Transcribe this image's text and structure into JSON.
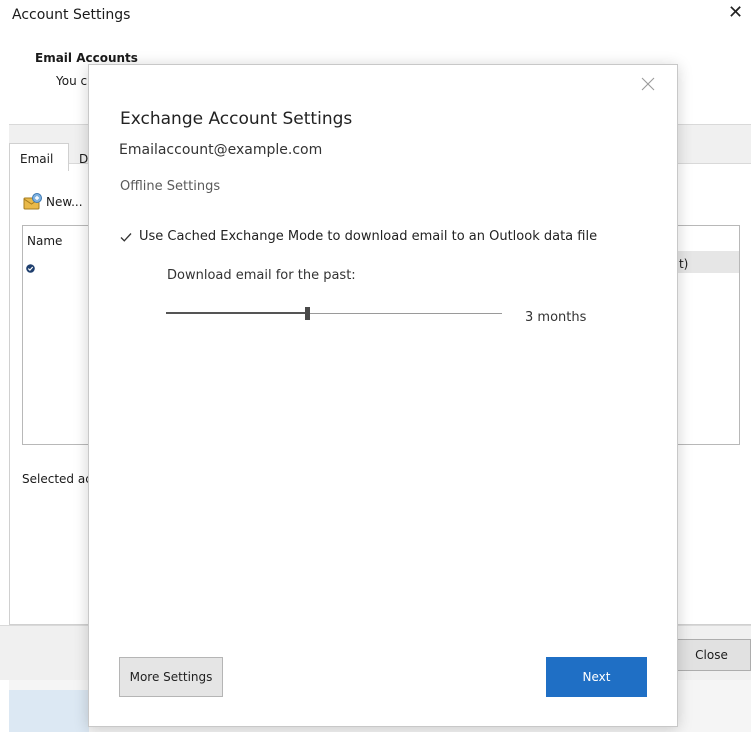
{
  "background_window": {
    "title": "Account Settings",
    "close_glyph": "✕",
    "section_heading": "Email Accounts",
    "description_partial": "You c",
    "tabs": [
      {
        "label": "Email",
        "selected": true
      },
      {
        "label": "D",
        "selected": false
      }
    ],
    "toolbar": {
      "new_label": "New...",
      "new_icon": "new-account-icon"
    },
    "list": {
      "header_name": "Name",
      "row_default_partial": "ult)",
      "default_marker_icon": "check-circle-icon"
    },
    "selected_text_partial": "Selected ac",
    "close_button_label": "Close"
  },
  "dialog": {
    "title": "Exchange Account Settings",
    "email": "Emailaccount@example.com",
    "section_label": "Offline Settings",
    "cached_mode": {
      "checked": true,
      "label": "Use Cached Exchange Mode to download email to an Outlook data file"
    },
    "download": {
      "label": "Download email for the past:",
      "value_text": "3 months",
      "slider_fraction": 0.42
    },
    "buttons": {
      "more_settings": "More Settings",
      "next": "Next"
    },
    "colors": {
      "primary": "#1f6fc5",
      "slider_thumb": "#4a4a4a"
    }
  }
}
